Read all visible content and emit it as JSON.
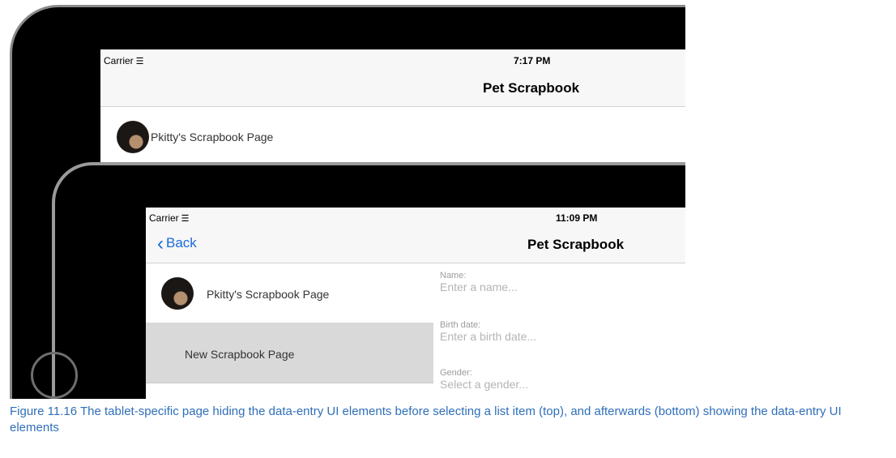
{
  "top_screen": {
    "status": {
      "carrier": "Carrier",
      "time": "7:17 PM"
    },
    "nav_title": "Pet Scrapbook",
    "list": [
      {
        "label": "Pkitty's Scrapbook Page"
      }
    ]
  },
  "bottom_screen": {
    "status": {
      "carrier": "Carrier",
      "time": "11:09 PM"
    },
    "back_label": "Back",
    "nav_title": "Pet Scrapbook",
    "list": [
      {
        "label": "Pkitty's Scrapbook Page"
      },
      {
        "label": "New Scrapbook Page"
      }
    ],
    "form": {
      "name_label": "Name:",
      "name_placeholder": "Enter a name...",
      "birth_label": "Birth date:",
      "birth_placeholder": "Enter a birth date...",
      "gender_label": "Gender:",
      "gender_placeholder": "Select a gender..."
    }
  },
  "caption": "Figure 11.16 The tablet-specific page hiding the data-entry UI elements before selecting a list item (top), and afterwards (bottom) showing the data-entry UI elements"
}
